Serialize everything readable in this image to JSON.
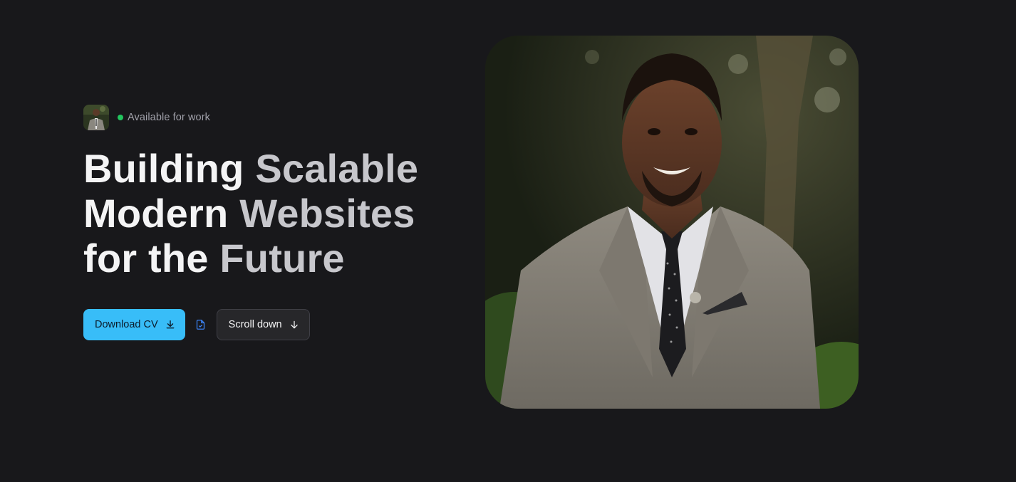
{
  "status": {
    "text": "Available for work",
    "dot_color": "#22c55e"
  },
  "headline": {
    "line1": {
      "strong": "Building",
      "muted": "Scalable"
    },
    "line2": {
      "strong": "Modern",
      "muted": "Websites"
    },
    "line3": {
      "strong": "for the",
      "muted": "Future"
    }
  },
  "actions": {
    "download_label": "Download CV",
    "download_icon": "download-icon",
    "doc_icon": "document-icon",
    "scroll_label": "Scroll down",
    "scroll_icon": "arrow-down-icon"
  },
  "colors": {
    "accent": "#38bdf8",
    "background": "#18181b",
    "doc_icon": "#3b82f6"
  },
  "images": {
    "avatar": "profile-photo",
    "portrait": "portrait-photo"
  }
}
